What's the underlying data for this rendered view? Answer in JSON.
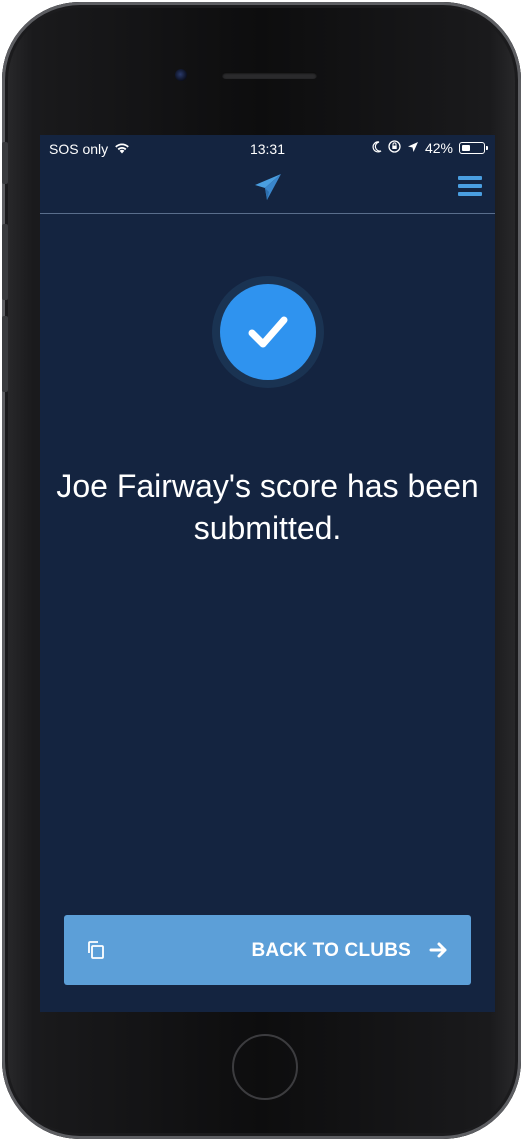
{
  "status_bar": {
    "carrier": "SOS only",
    "time": "13:31",
    "battery_percent": "42%",
    "battery_level": 0.42,
    "icons": [
      "wifi-icon",
      "moon-icon",
      "orientation-lock-icon",
      "location-arrow-icon",
      "battery-icon"
    ]
  },
  "nav": {
    "logo_icon": "paper-plane-icon",
    "menu_icon": "hamburger-menu-icon"
  },
  "confirmation": {
    "icon": "checkmark-icon",
    "line1": "Joe Fairway's score has been",
    "line2": "submitted."
  },
  "back_button": {
    "label": "BACK TO CLUBS",
    "leading_icon": "copy-icon",
    "trailing_icon": "arrow-right-icon"
  },
  "colors": {
    "screen_background": "#142440",
    "accent": "#4a9ee0",
    "check_circle": "#2f93ef",
    "button": "#5c9fd8"
  }
}
